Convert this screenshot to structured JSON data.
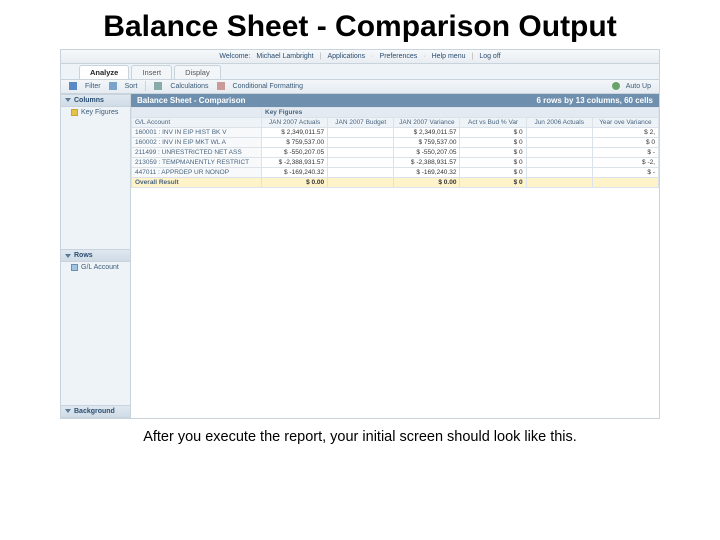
{
  "slide_title": "Balance Sheet - Comparison Output",
  "caption": "After you execute the report, your initial screen should look like this.",
  "topbar": {
    "welcome": "Welcome:",
    "user": "Michael Lambright",
    "links": [
      "Applications",
      "Preferences",
      "Help menu",
      "Log off"
    ]
  },
  "tabs": {
    "items": [
      "Analyze",
      "Insert",
      "Display"
    ],
    "active": 0
  },
  "toolbar": {
    "filter": "Filter",
    "sort": "Sort",
    "calc": "Calculations",
    "cond": "Conditional Formatting",
    "auto": "Auto Up"
  },
  "sidebar": {
    "columns": {
      "title": "Columns",
      "item": "Key Figures"
    },
    "rows": {
      "title": "Rows",
      "item": "G/L Account"
    },
    "background": {
      "title": "Background"
    }
  },
  "report": {
    "title": "Balance Sheet - Comparison",
    "status": "6 rows by 13 columns, 60 cells",
    "gl_label": "G/L Account",
    "kf_label": "Key Figures",
    "columns": [
      "JAN 2007 Actuals",
      "JAN 2007 Budget",
      "JAN 2007 Variance",
      "Act vs Bud % Var",
      "Jun 2006 Actuals",
      "Year ove Variance"
    ],
    "rows": [
      {
        "acct": "160001 : INV IN EIP HIST BK V",
        "cells": [
          "$ 2,349,011.57",
          "",
          "$ 2,349,011.57",
          "$ 0",
          "",
          "$ 2,"
        ]
      },
      {
        "acct": "160002 : INV IN EIP MKT WL A",
        "cells": [
          "$ 759,537.00",
          "",
          "$ 759,537.00",
          "$ 0",
          "",
          "$ 0"
        ]
      },
      {
        "acct": "211499 : UNRESTRICTED NET ASS",
        "cells": [
          "$ -550,207.05",
          "",
          "$ -550,207.05",
          "$ 0",
          "",
          "$ -"
        ]
      },
      {
        "acct": "213059 : TEMPMANENTLY RESTRICT",
        "cells": [
          "$ -2,388,931.57",
          "",
          "$ -2,388,931.57",
          "$ 0",
          "",
          "$ -2,"
        ]
      },
      {
        "acct": "447011 : APPRDEP UR NONOP",
        "cells": [
          "$ -169,240.32",
          "",
          "$ -169,240.32",
          "$ 0",
          "",
          "$ -"
        ]
      }
    ],
    "overall": {
      "label": "Overall Result",
      "cells": [
        "$ 0.00",
        "",
        "$ 0.00",
        "$ 0",
        "",
        ""
      ]
    }
  }
}
